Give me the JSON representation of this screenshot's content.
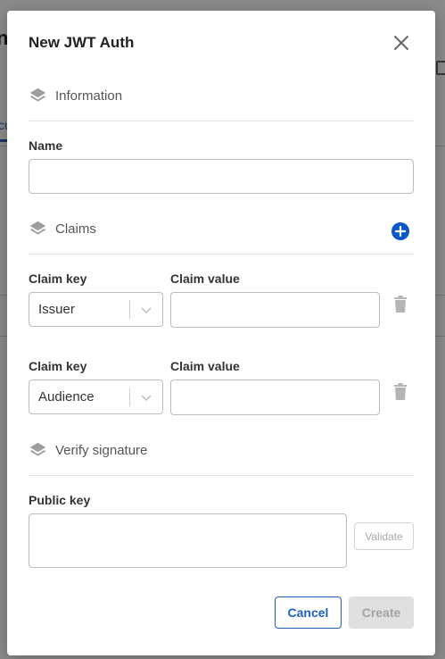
{
  "background": {
    "title_fragment": "ne",
    "tab_fragment": "cu"
  },
  "modal": {
    "title": "New JWT Auth",
    "sections": {
      "information": "Information",
      "claims": "Claims",
      "verify_signature": "Verify signature"
    },
    "name": {
      "label": "Name",
      "value": "",
      "placeholder": ""
    },
    "claims": [
      {
        "key_label": "Claim key",
        "key_value": "Issuer",
        "value_label": "Claim value",
        "value": ""
      },
      {
        "key_label": "Claim key",
        "key_value": "Audience",
        "value_label": "Claim value",
        "value": ""
      }
    ],
    "public_key": {
      "label": "Public key",
      "value": ""
    },
    "buttons": {
      "validate": "Validate",
      "cancel": "Cancel",
      "create": "Create"
    }
  },
  "colors": {
    "accent": "#1f5fbf",
    "add_button": "#0a57c9",
    "disabled_bg": "#e0e0e0",
    "disabled_text": "#a3a3a3",
    "icon_gray": "#9e9e9e"
  },
  "icons": {
    "close": "close-icon",
    "section": "layers-icon",
    "add": "plus-circle-icon",
    "delete": "trash-icon",
    "dropdown": "chevron-down-icon"
  }
}
